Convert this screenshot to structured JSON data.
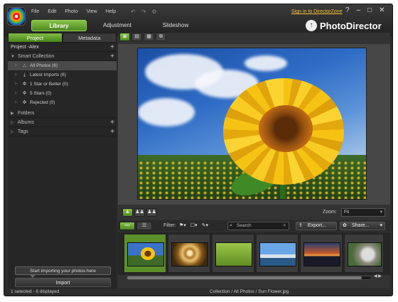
{
  "menu": [
    "File",
    "Edit",
    "Photo",
    "View",
    "Help"
  ],
  "signin": "Sign in to DirectorZone",
  "window_buttons": [
    "?",
    "–",
    "□",
    "✕"
  ],
  "tabs": [
    {
      "label": "Library",
      "active": true
    },
    {
      "label": "Adjustment",
      "active": false
    },
    {
      "label": "Slideshow",
      "active": false
    }
  ],
  "brand": "PhotoDirector",
  "panel_tabs": [
    "Project",
    "Metadata"
  ],
  "project": "Project -Alex",
  "smart_collection": {
    "label": "Smart Collection",
    "items": [
      {
        "label": "All Photos (6)",
        "selected": true
      },
      {
        "label": "Latest Imports (6)",
        "selected": false
      },
      {
        "label": "1 Star or Better (0)",
        "selected": false
      },
      {
        "label": "5 Stars (0)",
        "selected": false
      },
      {
        "label": "Rejected (0)",
        "selected": false
      }
    ]
  },
  "sections": [
    "Folders",
    "Albums",
    "Tags"
  ],
  "hint": "Start importing your photos here",
  "import_label": "Import",
  "zoom": {
    "label": "Zoom:",
    "value": "Fit"
  },
  "filter_label": "Filter:",
  "search_placeholder": "Search",
  "export_label": "Export...",
  "share_label": "Share...",
  "status": {
    "left": "1 selected - 6 displayed",
    "right": "Collection / All Photos / Sun Flower.jpg"
  },
  "accent_color": "#6aaa32",
  "signin_color": "#f4c33a"
}
